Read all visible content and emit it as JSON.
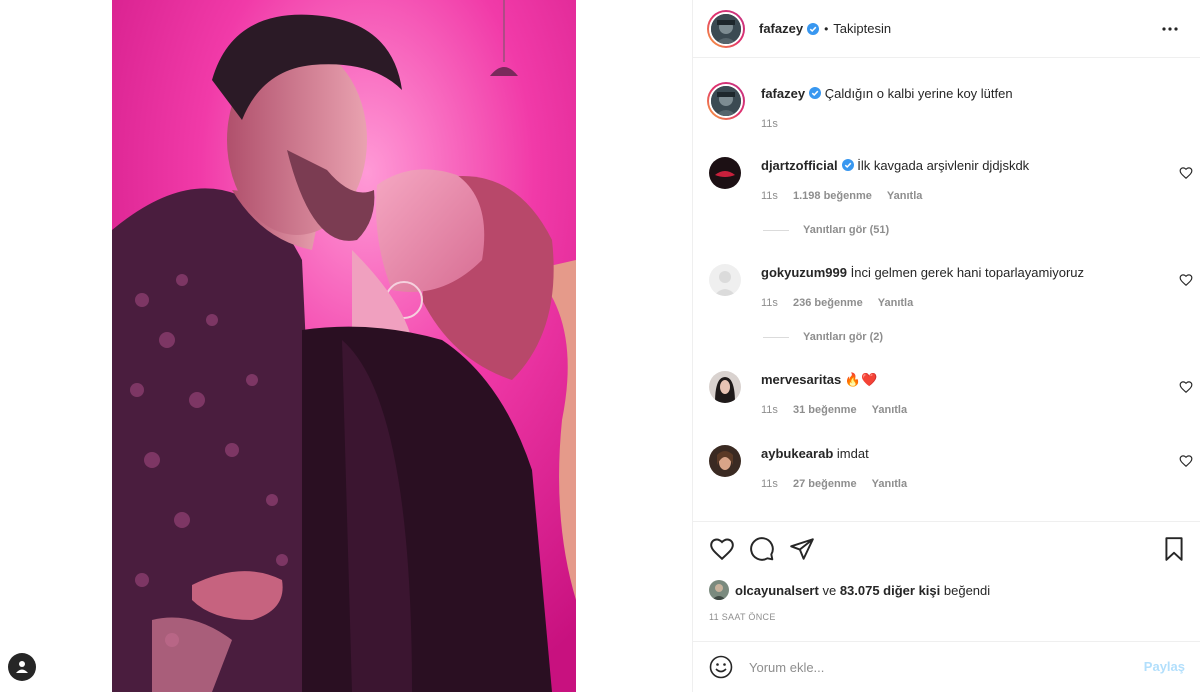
{
  "post": {
    "author": "fafazey",
    "follow_status": "Takiptesin",
    "separator": "•",
    "caption": "Çaldığın o kalbi yerine koy lütfen",
    "caption_time": "11s",
    "photo_alt": "post-photo"
  },
  "comments": [
    {
      "user": "djartzofficial",
      "verified": true,
      "text": "İlk kavgada arşivlenir djdjskdk",
      "time": "11s",
      "likes": "1.198 beğenme",
      "reply": "Yanıtla",
      "view_replies": "Yanıtları gör (51)"
    },
    {
      "user": "gokyuzum999",
      "verified": false,
      "text": "İnci gelmen gerek hani toparlayamiyoruz",
      "time": "11s",
      "likes": "236 beğenme",
      "reply": "Yanıtla",
      "view_replies": "Yanıtları gör (2)"
    },
    {
      "user": "mervesaritas",
      "verified": false,
      "text": "🔥❤️",
      "time": "11s",
      "likes": "31 beğenme",
      "reply": "Yanıtla"
    },
    {
      "user": "aybukearab",
      "verified": false,
      "text": "imdat",
      "time": "11s",
      "likes": "27 beğenme",
      "reply": "Yanıtla"
    }
  ],
  "likes": {
    "first_user": "olcayunalsert",
    "conjunction": "ve",
    "others": "83.075 diğer kişi",
    "suffix": "beğendi"
  },
  "posted_ago": "11 SAAT ÖNCE",
  "comment_box": {
    "placeholder": "Yorum ekle...",
    "post_label": "Paylaş"
  },
  "icons": {
    "more": "more-icon",
    "like": "heart-icon",
    "comment": "comment-icon",
    "share": "share-icon",
    "save": "bookmark-icon",
    "emoji": "emoji-icon",
    "verified": "verified-badge-icon",
    "account": "profile-icon"
  },
  "colors": {
    "photo_magenta": "#e01f95",
    "verified_blue": "#3897f0",
    "post_button_disabled": "#b2dffc",
    "meta_gray": "#8e8e8e"
  }
}
